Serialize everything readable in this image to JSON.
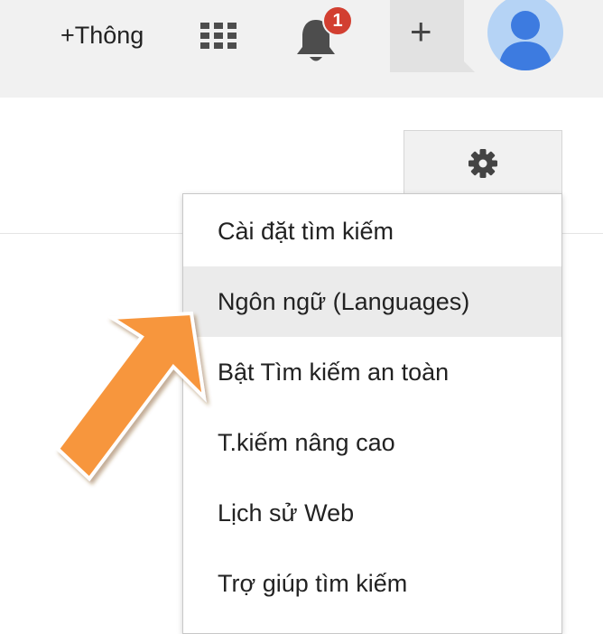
{
  "header": {
    "plus_link": "+Thông",
    "notification_count": "1",
    "icons": {
      "apps": "apps-grid-icon",
      "notifications": "bell-icon",
      "share": "plus-icon",
      "account": "avatar-icon"
    }
  },
  "settings": {
    "icon": "gear-icon"
  },
  "menu": {
    "items": [
      {
        "label": "Cài đặt tìm kiếm"
      },
      {
        "label": "Ngôn ngữ  (Languages)"
      },
      {
        "label": "Bật Tìm kiếm an toàn"
      },
      {
        "label": "T.kiếm nâng cao"
      },
      {
        "label": "Lịch sử Web"
      },
      {
        "label": "Trợ giúp tìm kiếm"
      }
    ],
    "highlighted_index": 1
  },
  "annotation": {
    "arrow_icon": "pointer-arrow",
    "arrow_color": "#f7963e"
  },
  "colors": {
    "topbar_bg": "#f1f1f1",
    "badge": "#d23f31",
    "avatar_bg": "#b5d3f5",
    "avatar_fg": "#3d7be0",
    "menu_hover": "#ebebeb"
  }
}
